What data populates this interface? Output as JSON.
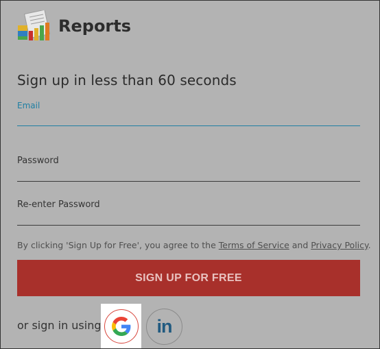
{
  "brand": {
    "name": "Reports",
    "logo_icon": "reports-chart-icon"
  },
  "form": {
    "headline": "Sign up in less than 60 seconds",
    "email": {
      "label": "Email",
      "value": ""
    },
    "password": {
      "label": "Password",
      "value": ""
    },
    "repassword": {
      "label": "Re-enter Password",
      "value": ""
    }
  },
  "terms": {
    "prefix": "By clicking 'Sign Up for Free', you agree to the ",
    "tos_link": "Terms of Service",
    "and": " and ",
    "privacy_link": "Privacy Policy",
    "suffix": "."
  },
  "signup_button": {
    "label": "SIGN UP FOR FREE"
  },
  "social": {
    "or_text": "or sign in using",
    "google_icon": "google-icon",
    "linkedin_icon": "linkedin-icon",
    "linkedin_text": "in"
  },
  "colors": {
    "overlay_bg": "#b3b3b3",
    "button_bg": "#a8302b",
    "focus": "#1e7fa3",
    "linkedin": "#215a80"
  }
}
